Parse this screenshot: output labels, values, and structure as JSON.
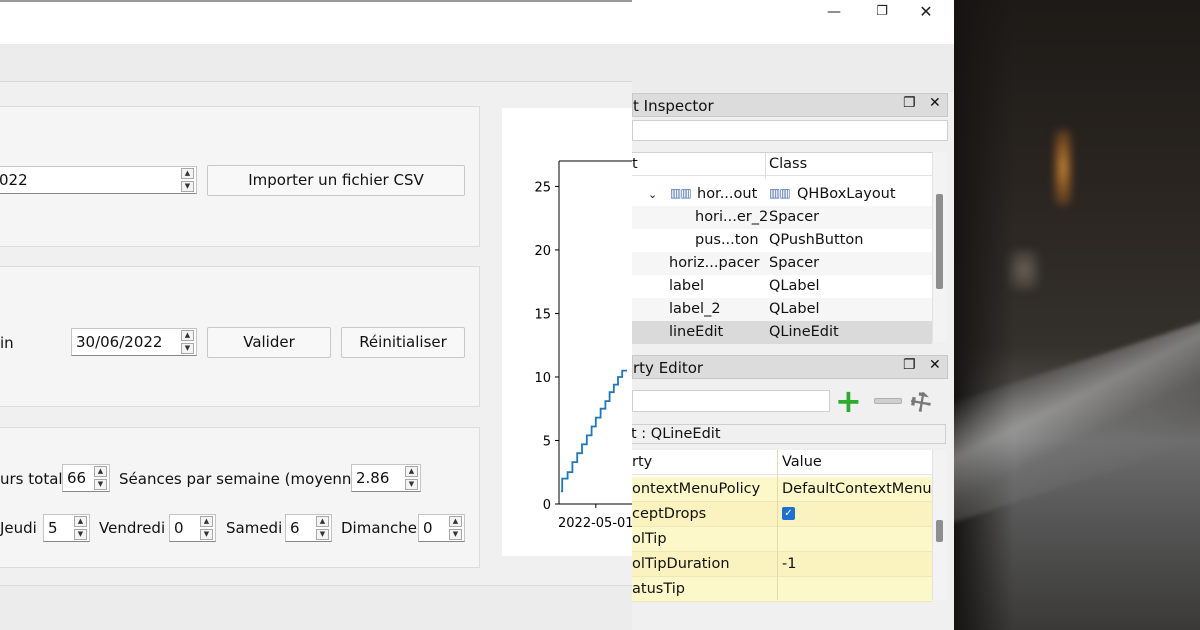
{
  "app": {
    "date_spin_1": "022",
    "import_button": "Importer un fichier CSV",
    "end_label": "in",
    "end_date": "30/06/2022",
    "validate_button": "Valider",
    "reset_button": "Réinitialiser",
    "total_label": "urs total",
    "total_value": "66",
    "weekly_label": "Séances par semaine (moyenne)",
    "weekly_value": "2.86",
    "days": [
      {
        "label": "Jeudi",
        "value": "5"
      },
      {
        "label": "Vendredi",
        "value": "0"
      },
      {
        "label": "Samedi",
        "value": "6"
      },
      {
        "label": "Dimanche",
        "value": "0"
      }
    ]
  },
  "chart_data": {
    "type": "line",
    "yticks": [
      0,
      5,
      10,
      15,
      20,
      25
    ],
    "xtick_label": "2022-05-01",
    "ylim": [
      0,
      27
    ],
    "color": "#1f77b4",
    "series": [
      {
        "x": [
          0,
          0.1,
          0.1,
          0.55,
          0.55,
          0.95,
          0.95,
          1.35,
          1.35,
          1.75,
          1.75,
          2.15,
          2.15,
          2.55,
          2.55,
          2.9,
          2.9,
          3.3,
          3.3,
          3.7,
          3.7,
          4.05,
          4.05,
          4.4,
          4.4,
          4.75,
          4.75,
          5.1,
          5.1,
          5.5
        ],
        "y": [
          1,
          1,
          2,
          2,
          2.5,
          2.5,
          3.3,
          3.3,
          4,
          4,
          4.7,
          4.7,
          5.4,
          5.4,
          6.1,
          6.1,
          6.8,
          6.8,
          7.5,
          7.5,
          8.1,
          8.1,
          8.8,
          8.8,
          9.4,
          9.4,
          10,
          10,
          10.5,
          10.5
        ]
      }
    ],
    "grid": false
  },
  "designer": {
    "object_inspector_title": "t Inspector",
    "tree_header_col1": "t",
    "tree_header_col2": "Class",
    "tree_rows": [
      {
        "name": "hor...out",
        "class": "QHBoxLayout",
        "indent": 1
      },
      {
        "name": "hori...er_2",
        "class": "Spacer",
        "indent": 2
      },
      {
        "name": "pus...ton",
        "class": "QPushButton",
        "indent": 2
      },
      {
        "name": "horiz...pacer",
        "class": "Spacer",
        "indent": 0
      },
      {
        "name": "label",
        "class": "QLabel",
        "indent": 0
      },
      {
        "name": "label_2",
        "class": "QLabel",
        "indent": 0
      },
      {
        "name": "lineEdit",
        "class": "QLineEdit",
        "indent": 0
      }
    ],
    "property_editor_title": "rty Editor",
    "object_line": "t : QLineEdit",
    "prop_header_col1": "rty",
    "prop_header_col2": "Value",
    "props": [
      {
        "name": "ontextMenuPolicy",
        "value": "DefaultContextMenu"
      },
      {
        "name": "ceptDrops",
        "value": ""
      },
      {
        "name": "olTip",
        "value": ""
      },
      {
        "name": "olTipDuration",
        "value": "-1"
      },
      {
        "name": "atusTip",
        "value": ""
      }
    ],
    "window_buttons": {
      "minimize": "—",
      "restore": "❐",
      "close": "✕"
    }
  }
}
